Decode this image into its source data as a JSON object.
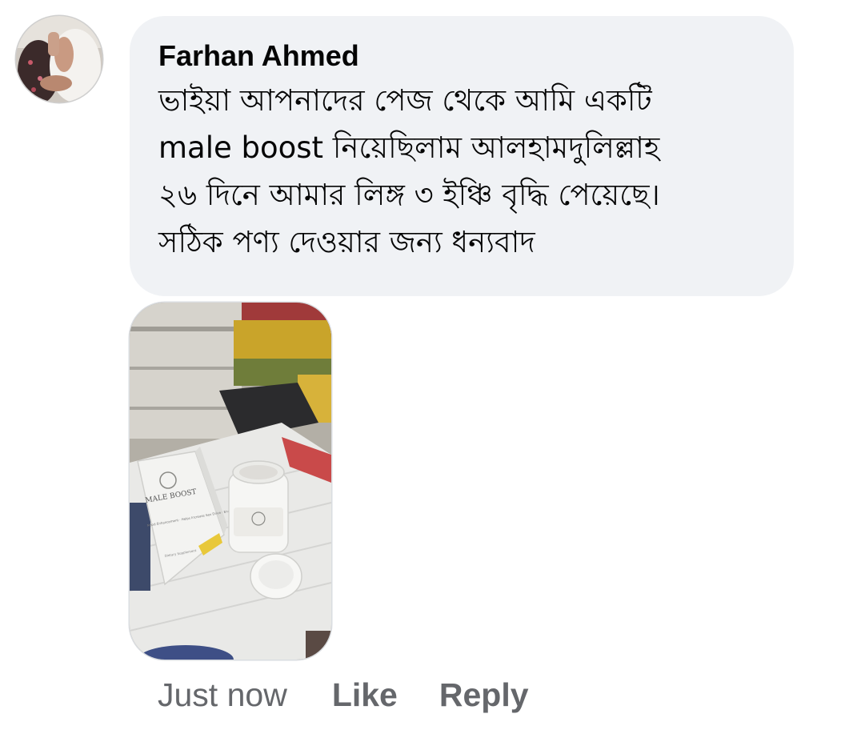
{
  "comment": {
    "author": "Farhan Ahmed",
    "lines": [
      "ভাইয়া আপনাদের পেজ থেকে আমি একটি",
      "male boost  নিয়েছিলাম আলহামদুলিল্লাহ",
      "২৬ দিনে আমার লিঙ্গ ৩ ইঞ্চি বৃদ্ধি পেয়েছে।",
      "সঠিক পণ্য দেওয়ার জন্য ধন্যবাদ"
    ],
    "attachment": {
      "box_brand": "MALE BOOST",
      "box_tagline": "Mood Enhancement · Helps Increase Sex Drive · Endurance",
      "box_footer": "Dietary Supplement"
    }
  },
  "footer": {
    "timestamp": "Just now",
    "like_label": "Like",
    "reply_label": "Reply"
  },
  "colors": {
    "bubble_bg": "#f0f2f5",
    "meta_text": "#65676b"
  }
}
